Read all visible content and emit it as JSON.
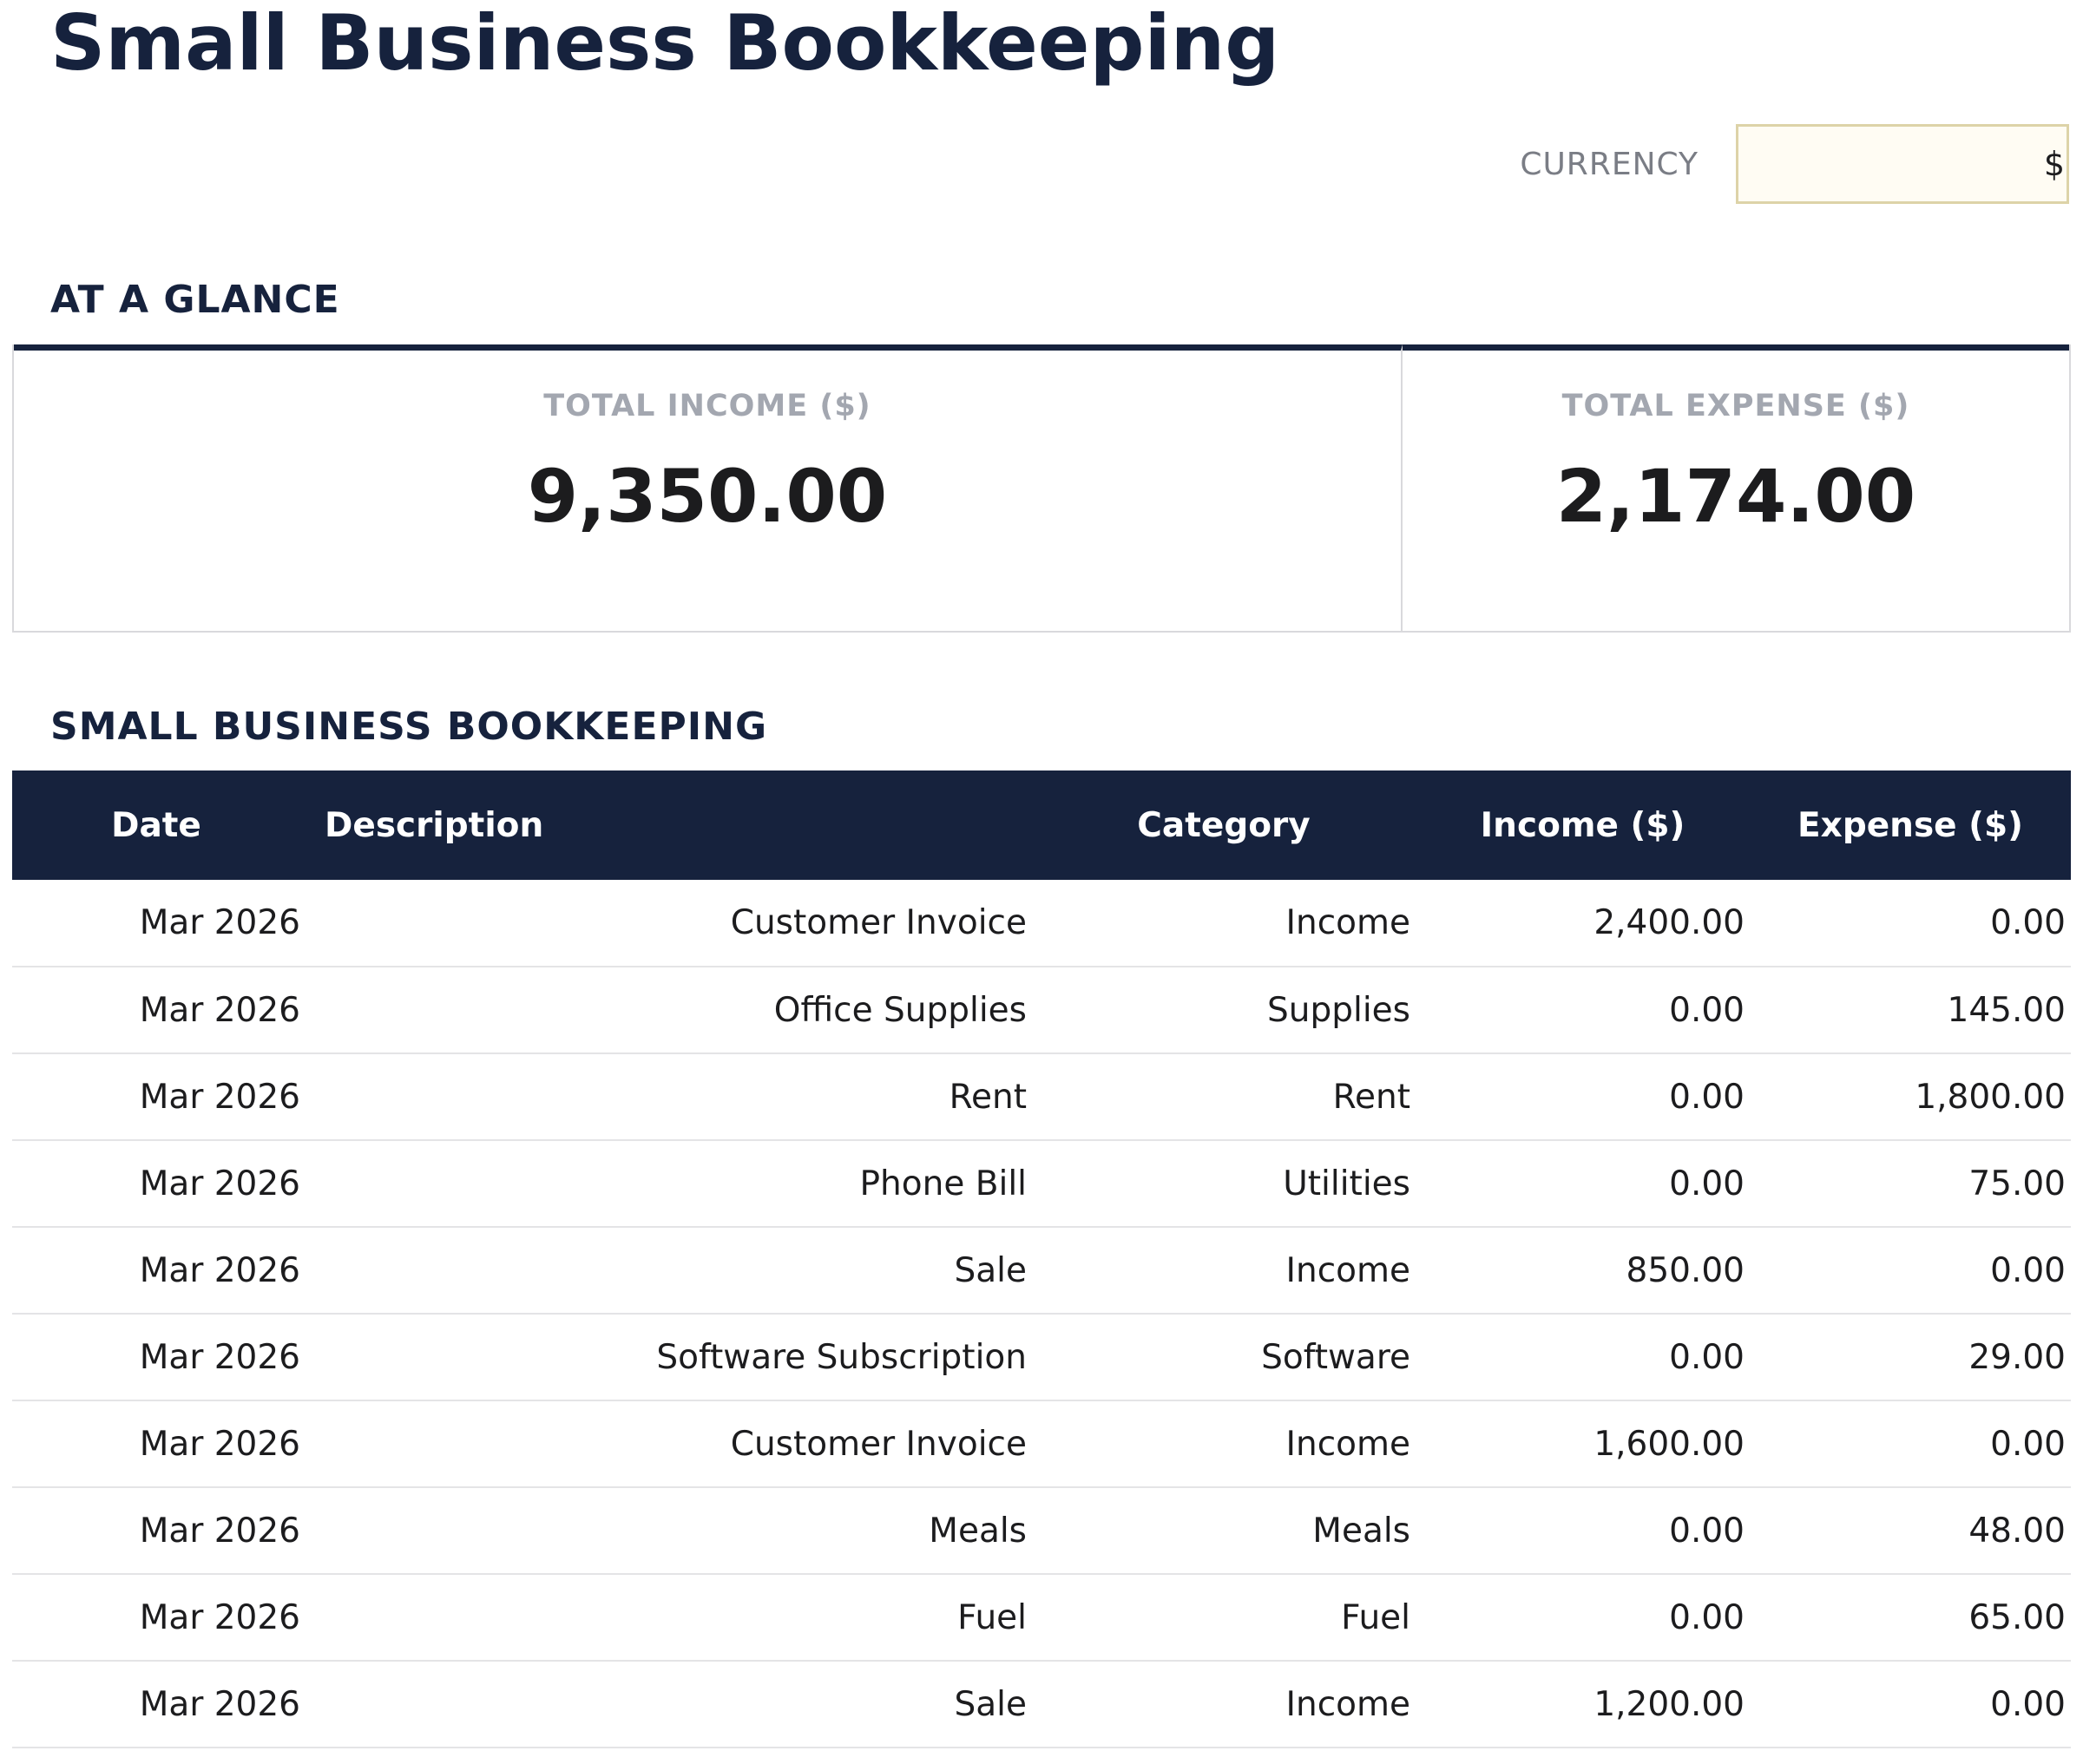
{
  "page": {
    "title": "Small Business Bookkeeping"
  },
  "currency": {
    "label": "CURRENCY",
    "value": "$"
  },
  "glance": {
    "title": "AT A GLANCE",
    "total_income_label": "TOTAL INCOME ($)",
    "total_income_value": "9,350.00",
    "total_expense_label": "TOTAL EXPENSE ($)",
    "total_expense_value": "2,174.00"
  },
  "ledger": {
    "title": "SMALL BUSINESS BOOKKEEPING",
    "columns": [
      "Date",
      "Description",
      "Category",
      "Income ($)",
      "Expense ($)"
    ],
    "rows": [
      [
        "Mar 2026",
        "Customer Invoice",
        "Income",
        "2,400.00",
        "0.00"
      ],
      [
        "Mar 2026",
        "Office Supplies",
        "Supplies",
        "0.00",
        "145.00"
      ],
      [
        "Mar 2026",
        "Rent",
        "Rent",
        "0.00",
        "1,800.00"
      ],
      [
        "Mar 2026",
        "Phone Bill",
        "Utilities",
        "0.00",
        "75.00"
      ],
      [
        "Mar 2026",
        "Sale",
        "Income",
        "850.00",
        "0.00"
      ],
      [
        "Mar 2026",
        "Software Subscription",
        "Software",
        "0.00",
        "29.00"
      ],
      [
        "Mar 2026",
        "Customer Invoice",
        "Income",
        "1,600.00",
        "0.00"
      ],
      [
        "Mar 2026",
        "Meals",
        "Meals",
        "0.00",
        "48.00"
      ],
      [
        "Mar 2026",
        "Fuel",
        "Fuel",
        "0.00",
        "65.00"
      ],
      [
        "Mar 2026",
        "Sale",
        "Income",
        "1,200.00",
        "0.00"
      ]
    ]
  },
  "colors": {
    "navy": "#16223d",
    "input_fill": "#fffcf3",
    "input_border": "#ddd3a8",
    "muted_label": "#a3a7b0"
  }
}
